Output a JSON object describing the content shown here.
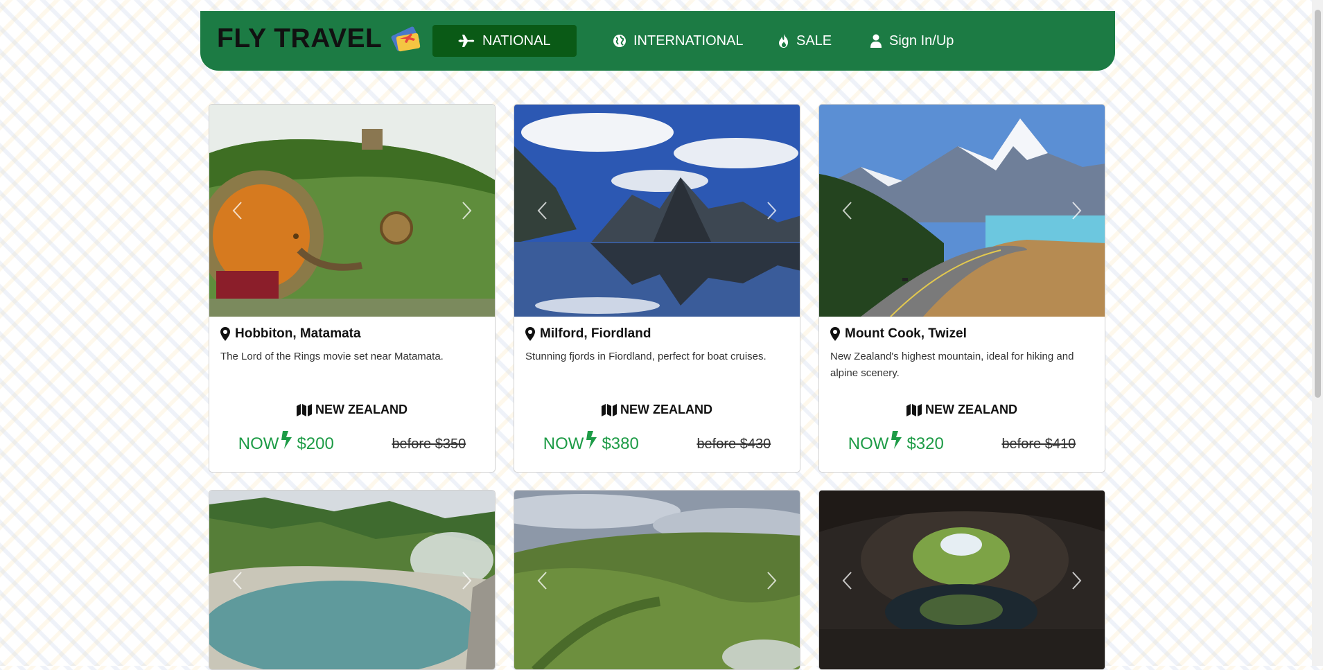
{
  "brand": {
    "name": "FLY TRAVEL",
    "logo_icon": "ticket-plane-icon"
  },
  "nav": {
    "national": "NATIONAL",
    "international": "INTERNATIONAL",
    "sale": "SALE",
    "signin": "Sign In/Up"
  },
  "colors": {
    "navbar": "#1c7b44",
    "active_nav": "#0a5a16",
    "price_green": "#1d9b46"
  },
  "cards": [
    {
      "title": "Hobbiton, Matamata",
      "description": "The Lord of the Rings movie set near Matamata.",
      "country": "NEW ZEALAND",
      "now_label": "NOW",
      "now_price": "$200",
      "before_price": "before $350"
    },
    {
      "title": "Milford, Fiordland",
      "description": "Stunning fjords in Fiordland, perfect for boat cruises.",
      "country": "NEW ZEALAND",
      "now_label": "NOW",
      "now_price": "$380",
      "before_price": "before $430"
    },
    {
      "title": "Mount Cook, Twizel",
      "description": "New Zealand's highest mountain, ideal for hiking and alpine scenery.",
      "country": "NEW ZEALAND",
      "now_label": "NOW",
      "now_price": "$320",
      "before_price": "before $410"
    }
  ]
}
